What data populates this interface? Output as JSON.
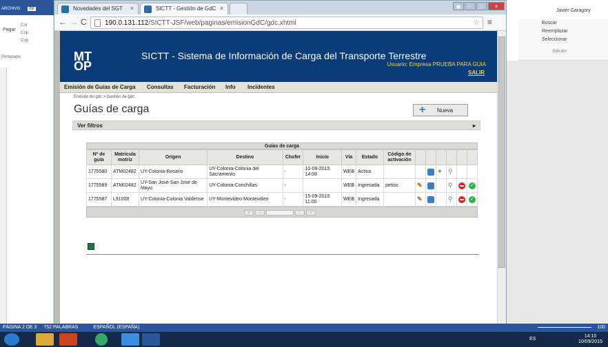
{
  "word": {
    "archivo": "ARCHIVO",
    "inicio": "INI",
    "left_cmds": [
      "Cor",
      "Cop",
      "Cop"
    ],
    "pegar": "Pegar",
    "portapapeles": "Portapape",
    "user": "Javier Garagory",
    "ribbon_right": [
      "Buscar",
      "Reemplazar",
      "Seleccionar"
    ],
    "edicion": "Edición",
    "status": {
      "page": "PÁGINA 2 DE 3",
      "words": "752 PALABRAS",
      "lang": "ESPAÑOL (ESPAÑA)",
      "zoom": "100"
    }
  },
  "browser": {
    "tabs": [
      {
        "label": "Novedades del SGT"
      },
      {
        "label": "SICTT - Gestión de GdC"
      }
    ],
    "url_host": "190.0.131.112",
    "url_path": "/SICTT-JSF/web/paginas/emisionGdC/gdc.xhtml"
  },
  "site": {
    "logo": "MT OP",
    "title": "SICTT - Sistema de Información de Carga del Transporte Terrestre",
    "usuario": "Usuario: Empresa PRUEBA PARA GUIA",
    "salir": "SALIR",
    "menu": [
      "Emisión de Guías de Carga",
      "Consultas",
      "Facturación",
      "Info",
      "Incidentes"
    ],
    "breadcrumb": "Emisión de gdc > Gestión de gdc",
    "page_title": "Guías de carga",
    "nueva": "Nueva",
    "ver_filtros": "Ver filtros",
    "table_caption": "Guías de carga",
    "columns": [
      "Nº de guía",
      "Matrícula motriz",
      "Origen",
      "Destino",
      "Chofer",
      "Inicio",
      "Vía",
      "Estado",
      "Código de activación"
    ],
    "rows": [
      {
        "guia": "1775580",
        "matricula": "ATM02482",
        "origen": "UY-Colonia-Rosario",
        "destino": "UY-Colonia-Colonia del Sacramento",
        "chofer": "-",
        "inicio": "10-09-2015 14:08",
        "via": "WEB",
        "estado": "Activa",
        "codigo": "",
        "actions": [
          "doc",
          "add",
          "search"
        ]
      },
      {
        "guia": "1775589",
        "matricula": "ATM02482",
        "origen": "UY-San José-San José de Mayo",
        "destino": "UY-Colonia-Conchillas",
        "chofer": "-",
        "inicio": "",
        "via": "WEB",
        "estado": "Ingresada",
        "codigo": "petiso",
        "actions": [
          "edit",
          "doc",
          "search",
          "stop",
          "ok"
        ]
      },
      {
        "guia": "1775587",
        "matricula": "L91008",
        "origen": "UY-Colonia-Colonia Valdense",
        "destino": "UY-Montevideo-Montevideo",
        "chofer": "-",
        "inicio": "15-09-2015 11:00",
        "via": "WEB",
        "estado": "Ingresada",
        "codigo": "",
        "actions": [
          "edit",
          "doc",
          "search",
          "stop",
          "ok"
        ]
      }
    ]
  },
  "taskbar": {
    "lang": "ES",
    "time": "14:10",
    "date": "10/09/2015"
  }
}
